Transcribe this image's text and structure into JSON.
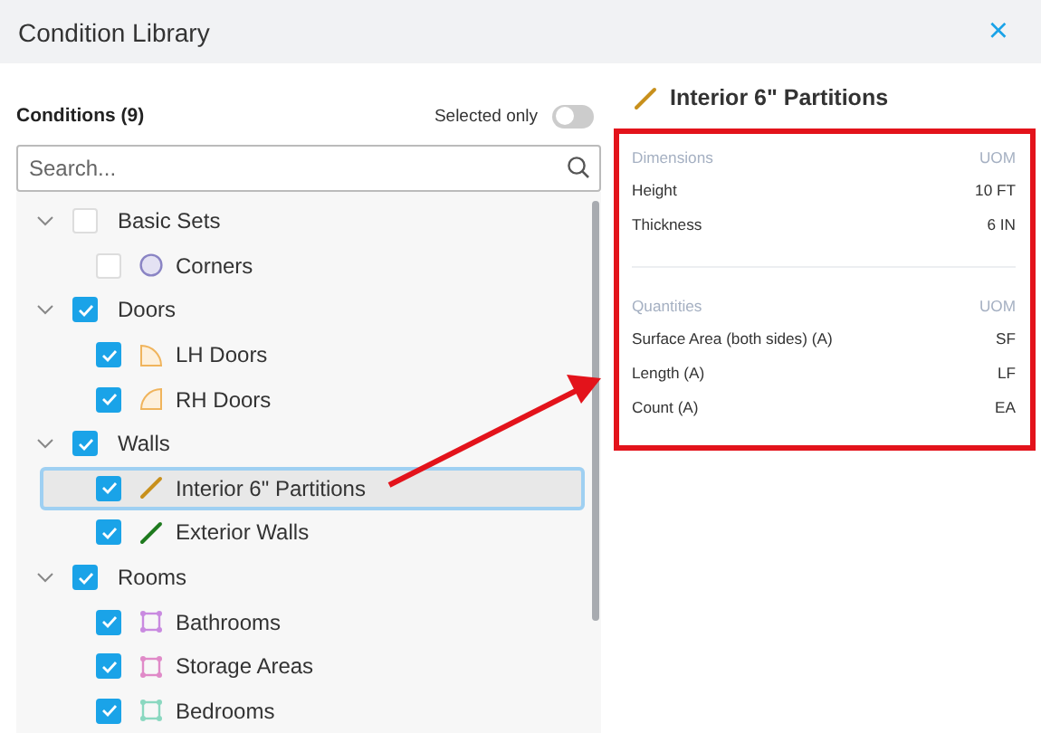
{
  "window": {
    "title": "Condition Library",
    "close": "×"
  },
  "conditions": {
    "heading": "Conditions (9)",
    "filter": {
      "label": "Selected only",
      "on": false
    },
    "search": {
      "placeholder": "Search..."
    },
    "tree": [
      {
        "label": "Basic Sets",
        "checked": false,
        "expanded": true,
        "selected": false,
        "children": [
          {
            "label": "Corners",
            "checked": false,
            "selected": false,
            "kind": "circle",
            "color": "#8a84c4"
          }
        ]
      },
      {
        "label": "Doors",
        "checked": true,
        "expanded": true,
        "selected": false,
        "children": [
          {
            "label": "LH Doors",
            "checked": true,
            "selected": false,
            "kind": "door-left",
            "color": "#f0b45c"
          },
          {
            "label": "RH Doors",
            "checked": true,
            "selected": false,
            "kind": "door-right",
            "color": "#f0b45c"
          }
        ]
      },
      {
        "label": "Walls",
        "checked": true,
        "expanded": true,
        "selected": false,
        "children": [
          {
            "label": "Interior 6\" Partitions",
            "checked": true,
            "selected": true,
            "kind": "line",
            "color": "#c8901c"
          },
          {
            "label": "Exterior Walls",
            "checked": true,
            "selected": false,
            "kind": "line",
            "color": "#1e7a1e"
          }
        ]
      },
      {
        "label": "Rooms",
        "checked": true,
        "expanded": true,
        "selected": false,
        "children": [
          {
            "label": "Bathrooms",
            "checked": true,
            "selected": false,
            "kind": "area",
            "color": "#c98ae0"
          },
          {
            "label": "Storage Areas",
            "checked": true,
            "selected": false,
            "kind": "area",
            "color": "#e08ac8"
          },
          {
            "label": "Bedrooms",
            "checked": true,
            "selected": false,
            "kind": "area",
            "color": "#8ad8c0"
          }
        ]
      }
    ]
  },
  "details": {
    "title": "Interior 6\" Partitions",
    "kind": "line",
    "color": "#c8901c",
    "sections": [
      {
        "heading": "Dimensions",
        "unit_heading": "UOM",
        "rows": [
          {
            "name": "Height",
            "value": "10 FT"
          },
          {
            "name": "Thickness",
            "value": "6 IN"
          }
        ]
      },
      {
        "heading": "Quantities",
        "unit_heading": "UOM",
        "rows": [
          {
            "name": "Surface Area (both sides) (A)",
            "value": "SF"
          },
          {
            "name": "Length (A)",
            "value": "LF"
          },
          {
            "name": "Count (A)",
            "value": "EA"
          }
        ]
      }
    ]
  }
}
